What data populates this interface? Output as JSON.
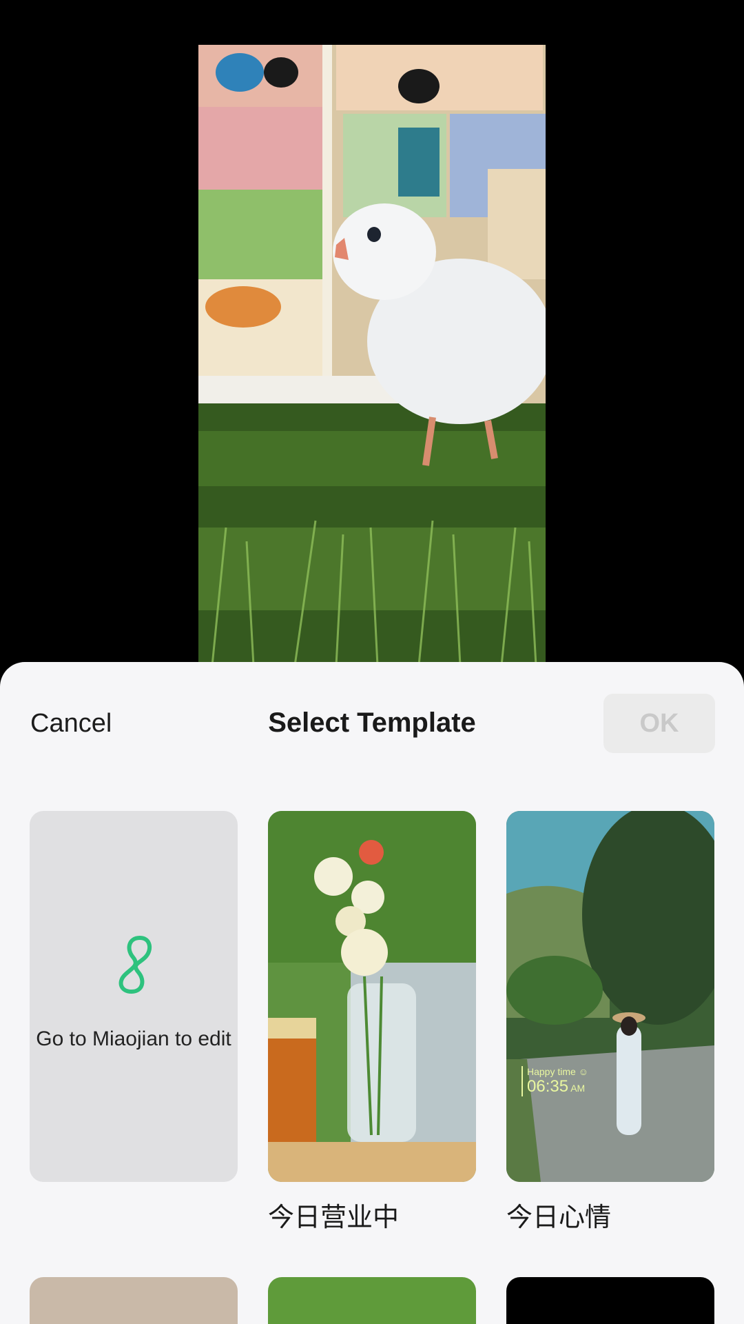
{
  "sheet": {
    "cancel_label": "Cancel",
    "title": "Select Template",
    "ok_label": "OK"
  },
  "templates": [
    {
      "label": "Go to Miaojian to edit",
      "icon": "miaojian-logo-icon"
    },
    {
      "caption": "今日营业中"
    },
    {
      "caption": "今日心情",
      "overlay_title": "Happy time ☺",
      "overlay_time": "06:35",
      "overlay_ampm": "AM"
    }
  ],
  "colors": {
    "accent": "#2ec27e",
    "ok_disabled_bg": "#ebebeb",
    "ok_disabled_text": "#c9c9c9",
    "sheet_bg": "#f6f6f8"
  }
}
